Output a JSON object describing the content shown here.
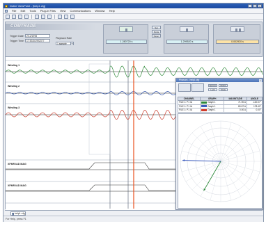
{
  "window": {
    "title": "Doble ViewPoint - [help1.cfg]"
  },
  "menu": [
    "File",
    "Edit",
    "Tools",
    "Plug-In Files",
    "View",
    "Communications",
    "Window",
    "Help"
  ],
  "header": {
    "section_title": "COMTRADE",
    "trigger_date_label": "Trigger Date",
    "trigger_date_value": "2/12/1998",
    "trigger_time_label": "Trigger Time",
    "trigger_time_value": "17:53:36.992377",
    "playback_label": "Playback Rate",
    "playback_value": "1 sample"
  },
  "readouts": [
    {
      "value": "1.280720 s"
    },
    {
      "value": "1.299520 s"
    },
    {
      "value": "0.002920 s"
    }
  ],
  "small_buttons": [
    "Set",
    "Delta",
    "Reset"
  ],
  "channels": [
    {
      "label": "Winding 1"
    },
    {
      "label": "Winding 2"
    },
    {
      "label": "Winding 3"
    },
    {
      "label": "XFMR I&D MAG"
    },
    {
      "label": "XFMR I&D MAG"
    }
  ],
  "phasor": {
    "title": "Phasors - help1.cfg",
    "buttons": [
      "Options",
      "Lock",
      "Status",
      "Scale"
    ],
    "table": {
      "headers": [
        "CHANNEL",
        "GRAPH",
        "MAGNITUDE",
        "ANGLE"
      ],
      "rows": [
        {
          "channel": "FILE 1: P1 IA",
          "graph": "Graph 1",
          "magnitude": "71.90 A",
          "angle": "-120.07°",
          "color": "#2c8a3a"
        },
        {
          "channel": "FILE 1: P1 IA",
          "graph": "Graph 1",
          "magnitude": "80.87 A",
          "angle": "178.40°",
          "color": "#3a5bbf"
        },
        {
          "channel": "FILE 1: P1 IA",
          "graph": "Graph 1",
          "magnitude": "0.00 A",
          "angle": "0.00°",
          "color": "#d13a2a"
        }
      ]
    }
  },
  "tab": {
    "label": "help1.cfg"
  },
  "status": {
    "text": "For Help, press F1"
  },
  "colors": {
    "accent": "#1c4aa2",
    "cursor": "#e8501e",
    "wave_green": "#2f8a3a",
    "wave_red": "#c83a2a",
    "wave_blue": "#2a4ea8",
    "cyan_readout": "#d8f1f4",
    "orange_readout": "#fde3a6"
  }
}
